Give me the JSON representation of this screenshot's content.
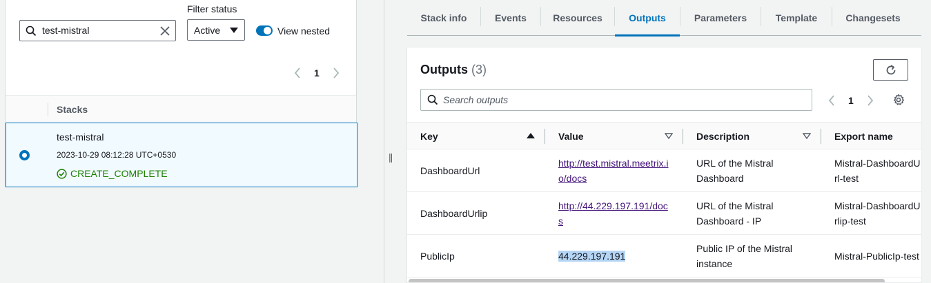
{
  "left": {
    "search": {
      "value": "test-mistral"
    },
    "filter_status": {
      "label": "Filter status",
      "selected": "Active"
    },
    "view_nested": {
      "label": "View nested",
      "enabled": true
    },
    "pagination": {
      "page": "1"
    },
    "table": {
      "header": "Stacks"
    },
    "stack": {
      "name": "test-mistral",
      "timestamp": "2023-10-29 08:12:28 UTC+0530",
      "status": "CREATE_COMPLETE"
    }
  },
  "splitter": {
    "handle": "||"
  },
  "tabs": [
    {
      "label": "Stack info"
    },
    {
      "label": "Events"
    },
    {
      "label": "Resources"
    },
    {
      "label": "Outputs"
    },
    {
      "label": "Parameters"
    },
    {
      "label": "Template"
    },
    {
      "label": "Changesets"
    }
  ],
  "outputs": {
    "title": "Outputs",
    "count": "(3)",
    "search_placeholder": "Search outputs",
    "pagination": {
      "page": "1"
    },
    "columns": [
      "Key",
      "Value",
      "Description",
      "Export name"
    ],
    "rows": [
      {
        "key": "DashboardUrl",
        "value": "http://test.mistral.meetrix.io/docs",
        "description": "URL of the Mistral Dashboard",
        "export": "Mistral-DashboardUrl-test"
      },
      {
        "key": "DashboardUrlip",
        "value": "http://44.229.197.191/docs",
        "description": "URL of the Mistral Dashboard - IP",
        "export": "Mistral-DashboardUrlip-test"
      },
      {
        "key": "PublicIp",
        "value": "44.229.197.191",
        "description": "Public IP of the Mistral instance",
        "export": "Mistral-PublicIp-test"
      }
    ]
  },
  "colors": {
    "accent": "#0073bb",
    "success": "#1d8102",
    "link_visited": "#44157a",
    "selection": "#b5d5f5"
  }
}
